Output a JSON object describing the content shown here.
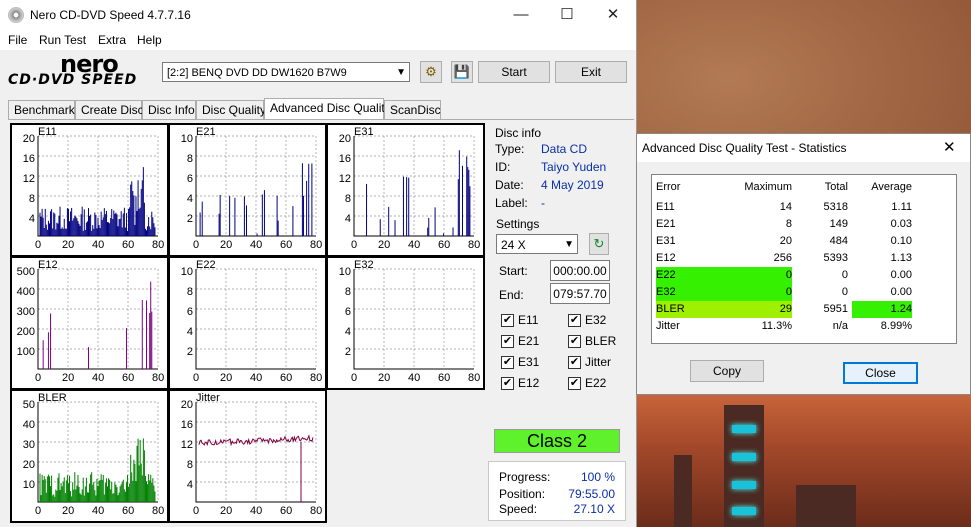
{
  "window": {
    "title": "Nero CD-DVD Speed 4.7.7.16"
  },
  "menu": [
    "File",
    "Run Test",
    "Extra",
    "Help"
  ],
  "logo": {
    "brand": "nero",
    "product": "CD·DVD SPEED"
  },
  "drive": {
    "selected": "[2:2]   BENQ DVD DD DW1620 B7W9"
  },
  "buttons": {
    "start": "Start",
    "exit": "Exit"
  },
  "tabs": [
    "Benchmark",
    "Create Disc",
    "Disc Info",
    "Disc Quality",
    "Advanced Disc Quality",
    "ScanDisc"
  ],
  "active_tab": "Advanced Disc Quality",
  "disc_info": {
    "heading": "Disc info",
    "type_label": "Type:",
    "type": "Data CD",
    "id_label": "ID:",
    "id": "Taiyo Yuden",
    "date_label": "Date:",
    "date": "4 May 2019",
    "label_label": "Label:",
    "label": "-"
  },
  "settings": {
    "heading": "Settings",
    "speed": "24 X",
    "start_label": "Start:",
    "start": "000:00.00",
    "end_label": "End:",
    "end": "079:57.70",
    "checks": [
      {
        "label": "E11",
        "checked": true
      },
      {
        "label": "E32",
        "checked": true
      },
      {
        "label": "E21",
        "checked": true
      },
      {
        "label": "BLER",
        "checked": true
      },
      {
        "label": "E31",
        "checked": true
      },
      {
        "label": "Jitter",
        "checked": true
      },
      {
        "label": "E12",
        "checked": true
      },
      {
        "label": "E22",
        "checked": true
      }
    ]
  },
  "class_badge": "Class 2",
  "progress": {
    "progress_label": "Progress:",
    "progress": "100 %",
    "position_label": "Position:",
    "position": "79:55.00",
    "speed_label": "Speed:",
    "speed": "27.10 X"
  },
  "graphs": [
    {
      "name": "E11",
      "yticks": [
        "20",
        "16",
        "12",
        "8",
        "4"
      ],
      "xticks": [
        "0",
        "20",
        "40",
        "60",
        "80"
      ],
      "color": "#000080"
    },
    {
      "name": "E21",
      "yticks": [
        "10",
        "8",
        "6",
        "4",
        "2"
      ],
      "xticks": [
        "0",
        "20",
        "40",
        "60",
        "80"
      ],
      "color": "#000080"
    },
    {
      "name": "E31",
      "yticks": [
        "20",
        "16",
        "12",
        "8",
        "4"
      ],
      "xticks": [
        "0",
        "20",
        "40",
        "60",
        "80"
      ],
      "color": "#000080"
    },
    {
      "name": "E12",
      "yticks": [
        "500",
        "400",
        "300",
        "200",
        "100"
      ],
      "xticks": [
        "0",
        "20",
        "40",
        "60",
        "80"
      ],
      "color": "#800080"
    },
    {
      "name": "E22",
      "yticks": [
        "10",
        "8",
        "6",
        "4",
        "2"
      ],
      "xticks": [
        "0",
        "20",
        "40",
        "60",
        "80"
      ],
      "color": "#000080"
    },
    {
      "name": "E32",
      "yticks": [
        "10",
        "8",
        "6",
        "4",
        "2"
      ],
      "xticks": [
        "0",
        "20",
        "40",
        "60",
        "80"
      ],
      "color": "#000080"
    },
    {
      "name": "BLER",
      "yticks": [
        "50",
        "40",
        "30",
        "20",
        "10"
      ],
      "xticks": [
        "0",
        "20",
        "40",
        "60",
        "80"
      ],
      "color": "#008000"
    },
    {
      "name": "Jitter",
      "yticks": [
        "20",
        "16",
        "12",
        "8",
        "4"
      ],
      "xticks": [
        "0",
        "20",
        "40",
        "60",
        "80"
      ],
      "color": "#800040"
    }
  ],
  "stats": {
    "title": "Advanced Disc Quality Test - Statistics",
    "headers": [
      "Error",
      "Maximum",
      "Total",
      "Average"
    ],
    "rows": [
      {
        "error": "E11",
        "maximum": "14",
        "total": "5318",
        "average": "1.11",
        "highlight": ""
      },
      {
        "error": "E21",
        "maximum": "8",
        "total": "149",
        "average": "0.03",
        "highlight": ""
      },
      {
        "error": "E31",
        "maximum": "20",
        "total": "484",
        "average": "0.10",
        "highlight": ""
      },
      {
        "error": "E12",
        "maximum": "256",
        "total": "5393",
        "average": "1.13",
        "highlight": ""
      },
      {
        "error": "E22",
        "maximum": "0",
        "total": "0",
        "average": "0.00",
        "highlight": "green"
      },
      {
        "error": "E32",
        "maximum": "0",
        "total": "0",
        "average": "0.00",
        "highlight": "green"
      },
      {
        "error": "BLER",
        "maximum": "29",
        "total": "5951",
        "average": "1.24",
        "highlight": "bler"
      },
      {
        "error": "Jitter",
        "maximum": "11.3%",
        "total": "n/a",
        "average": "8.99%",
        "highlight": ""
      }
    ],
    "copy": "Copy",
    "close": "Close"
  },
  "colors": {
    "green_highlight": "#35f000",
    "lime_highlight": "#9ff000",
    "class_badge": "#5ef12c"
  }
}
